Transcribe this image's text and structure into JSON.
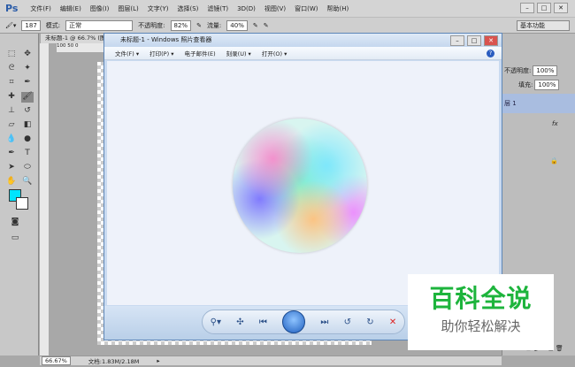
{
  "menubar": {
    "logo": "Ps",
    "items": [
      "文件(F)",
      "编辑(E)",
      "图像(I)",
      "图层(L)",
      "文字(Y)",
      "选择(S)",
      "滤镜(T)",
      "3D(D)",
      "视图(V)",
      "窗口(W)",
      "帮助(H)"
    ]
  },
  "options": {
    "brush_size": "187",
    "mode_label": "模式:",
    "mode_value": "正常",
    "opacity_label": "不透明度:",
    "opacity_value": "82%",
    "flow_label": "流量:",
    "flow_value": "40%",
    "workspace": "基本功能"
  },
  "document": {
    "tab": "未标题-1 @ 66.7% (图",
    "ruler": "100   50   0"
  },
  "viewer": {
    "title": "未标题-1 - Windows 照片查看器",
    "menu": [
      "文件(F) ▾",
      "打印(P) ▾",
      "电子邮件(E)",
      "刻录(U) ▾",
      "打开(O) ▾"
    ],
    "help": "?"
  },
  "layers": {
    "opacity_label": "不透明度:",
    "opacity_value": "100%",
    "fill_label": "填充:",
    "fill_value": "100%",
    "layer_name": "层 1",
    "fx": "fx"
  },
  "status": {
    "zoom": "66.67%",
    "doc": "文档:1.83M/2.18M"
  },
  "watermark": {
    "title": "百科全说",
    "subtitle": "助你轻松解决"
  },
  "colors": {
    "foreground": "#00e5ff",
    "background": "#ffffff",
    "layer_selected": "#a9bde0"
  }
}
